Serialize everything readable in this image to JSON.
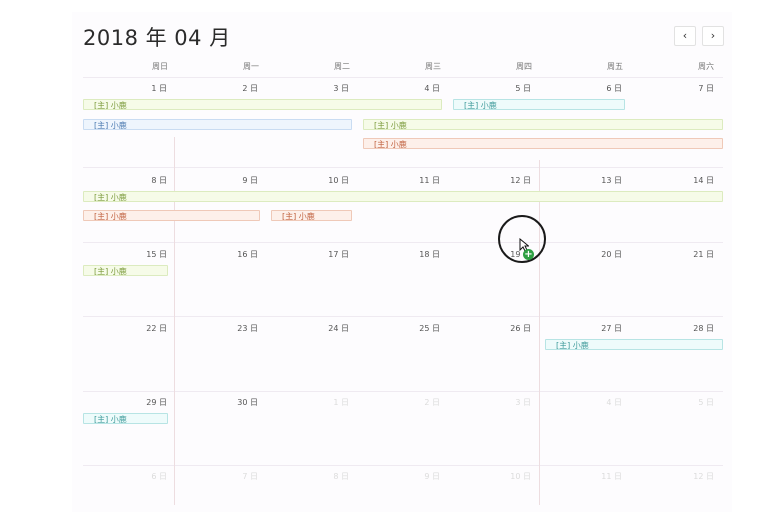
{
  "calendar": {
    "title": "2018 年 04 月",
    "prev_label": "‹",
    "next_label": "›",
    "weekdays": [
      "周日",
      "周一",
      "周二",
      "周三",
      "周四",
      "周五",
      "周六"
    ],
    "weeks": [
      [
        "1 日",
        "2 日",
        "3 日",
        "4 日",
        "5 日",
        "6 日",
        "7 日"
      ],
      [
        "8 日",
        "9 日",
        "10 日",
        "11 日",
        "12 日",
        "13 日",
        "14 日"
      ],
      [
        "15 日",
        "16 日",
        "17 日",
        "18 日",
        "19 日",
        "20 日",
        "21 日"
      ],
      [
        "22 日",
        "23 日",
        "24 日",
        "25 日",
        "26 日",
        "27 日",
        "28 日"
      ],
      [
        "29 日",
        "30 日",
        "1 日",
        "2 日",
        "3 日",
        "4 日",
        "5 日"
      ],
      [
        "6 日",
        "7 日",
        "8 日",
        "9 日",
        "10 日",
        "11 日",
        "12 日"
      ]
    ],
    "event_label": "[主] 小鹿",
    "colors": {
      "green": "#7a9a3a",
      "blue": "#4a79b0",
      "teal": "#3d9a9a",
      "salmon": "#c0603e",
      "add_badge": "#2ea043"
    }
  }
}
